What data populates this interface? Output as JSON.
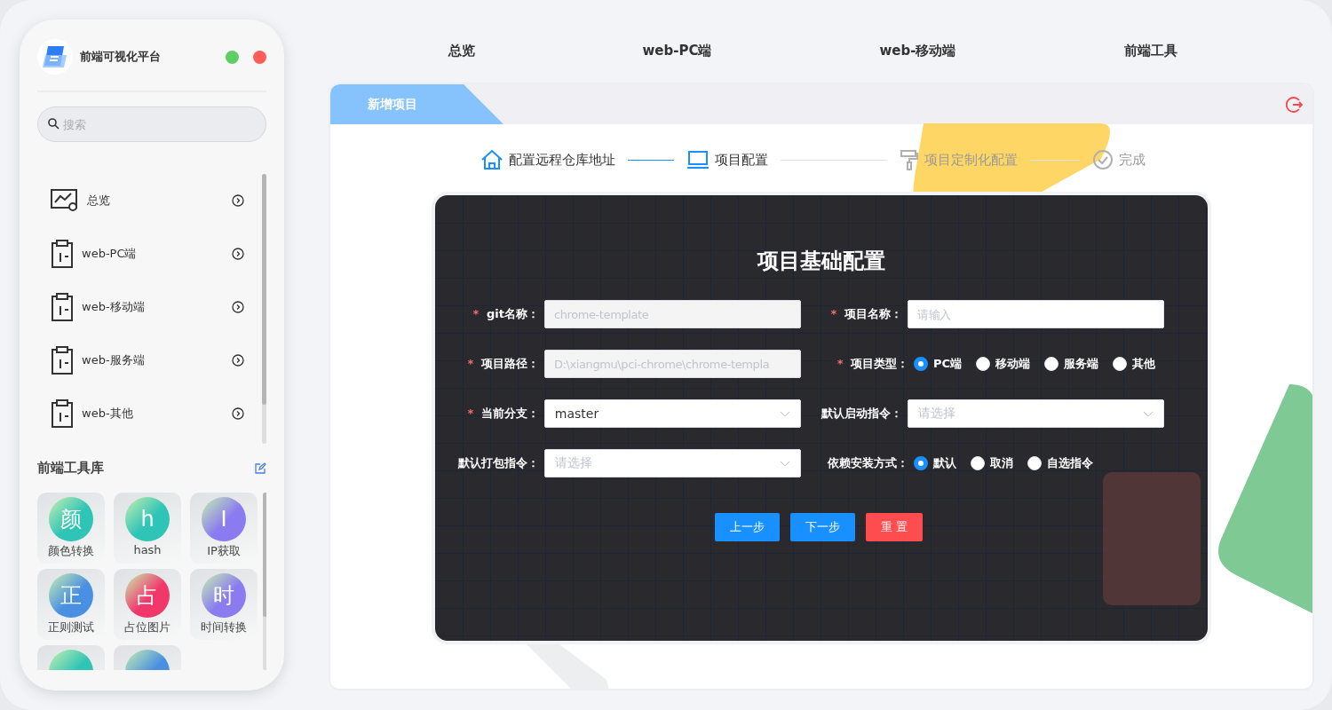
{
  "sidebar": {
    "title": "前端可视化平台",
    "search": {
      "placeholder": "搜索"
    },
    "nav_items": [
      {
        "kind": "overview",
        "label": "总览"
      },
      {
        "kind": "document",
        "label": "web-PC端"
      },
      {
        "kind": "document",
        "label": "web-移动端"
      },
      {
        "kind": "document",
        "label": "web-服务端"
      },
      {
        "kind": "document",
        "label": "web-其他"
      }
    ],
    "tools_title": "前端工具库",
    "tools": [
      {
        "glyph": "颜",
        "label": "颜色转换",
        "color": "#2ec4b6"
      },
      {
        "glyph": "h",
        "label": "hash",
        "color": "#2ec4b6"
      },
      {
        "glyph": "I",
        "label": "IP获取",
        "color": "#8a7cf0"
      },
      {
        "glyph": "正",
        "label": "正则测试",
        "color": "#4a90e2"
      },
      {
        "glyph": "占",
        "label": "占位图片",
        "color": "#f0386b"
      },
      {
        "glyph": "时",
        "label": "时间转换",
        "color": "#8a7cf0"
      },
      {
        "color": "#2ec4b6"
      },
      {
        "color": "#4a90e2"
      }
    ]
  },
  "top_nav": [
    "总览",
    "web-PC端",
    "web-移动端",
    "前端工具"
  ],
  "tab": {
    "label": "新增项目"
  },
  "steps": [
    {
      "kind": "home",
      "label": "配置远程仓库地址",
      "active": true
    },
    {
      "kind": "laptop",
      "label": "项目配置",
      "active": true
    },
    {
      "kind": "roller",
      "label": "项目定制化配置",
      "active": false
    },
    {
      "kind": "check",
      "label": "完成",
      "active": false
    }
  ],
  "form": {
    "title": "项目基础配置",
    "fields": [
      {
        "kind": "input",
        "label": "git名称：",
        "required_mark": "*",
        "value": "chrome-template",
        "disabled": true
      },
      {
        "kind": "input",
        "label": "项目名称：",
        "required_mark": "*",
        "placeholder": "请输入"
      },
      {
        "kind": "input",
        "label": "项目路径：",
        "required_mark": "*",
        "value": "D:\\xiangmu\\pci-chrome\\chrome-templa",
        "disabled": true
      },
      {
        "kind": "radio",
        "label": "项目类型：",
        "required_mark": "*",
        "options": [
          {
            "label": "PC端",
            "selected": true
          },
          {
            "label": "移动端",
            "selected": false
          },
          {
            "label": "服务端",
            "selected": false
          },
          {
            "label": "其他",
            "selected": false
          }
        ]
      },
      {
        "kind": "select",
        "label": "当前分支：",
        "required_mark": "*",
        "value": "master"
      },
      {
        "kind": "select",
        "label": "默认启动指令：",
        "placeholder": "请选择"
      },
      {
        "kind": "select",
        "label": "默认打包指令：",
        "placeholder": "请选择"
      },
      {
        "kind": "radio",
        "label": "依赖安装方式：",
        "options": [
          {
            "label": "默认",
            "selected": true
          },
          {
            "label": "取消",
            "selected": false
          },
          {
            "label": "自选指令",
            "selected": false
          }
        ]
      }
    ],
    "buttons": [
      {
        "kind": "primary",
        "label": "上一步"
      },
      {
        "kind": "primary",
        "label": "下一步"
      },
      {
        "kind": "danger",
        "label": "重 置"
      }
    ]
  }
}
